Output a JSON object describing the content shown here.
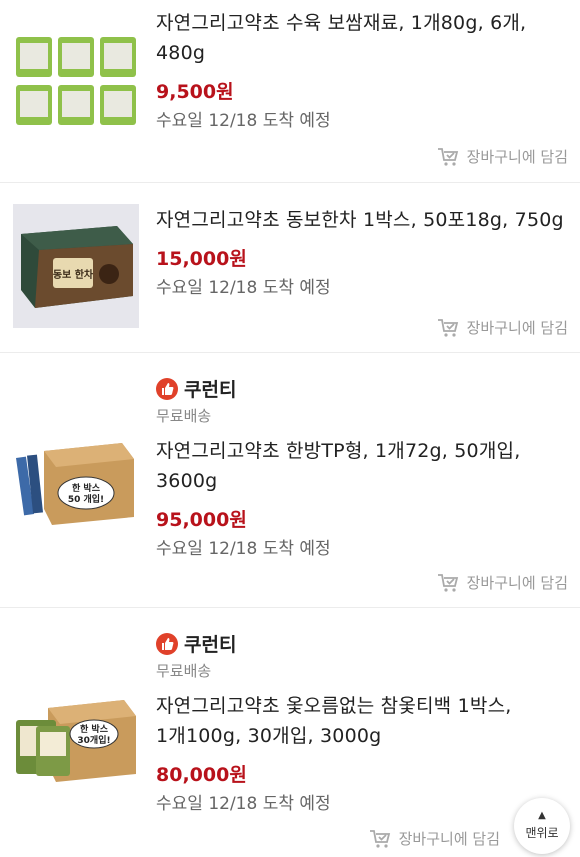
{
  "products": [
    {
      "title_line1": "자연그리고약초 수육 보쌈재료, 1개80g, 6개,",
      "title_line2": "480g",
      "price": "9,500원",
      "delivery": "수요일 12/18 도착 예정",
      "cart_label": "장바구니에 담김"
    },
    {
      "title_line1": "자연그리고약초 동보한차 1박스, 50포18g, 750g",
      "price": "15,000원",
      "delivery": "수요일 12/18 도착 예정",
      "cart_label": "장바구니에 담김",
      "box_text": "동보 한차"
    },
    {
      "brand_icon": "coupang-thumb",
      "brand": "쿠런티",
      "shipping": "무료배송",
      "title_line1": "자연그리고약초 한방TP형, 1개72g, 50개입,",
      "title_line2": "3600g",
      "price": "95,000원",
      "delivery": "수요일 12/18 도착 예정",
      "cart_label": "장바구니에 담김",
      "box_text_1": "한 박스",
      "box_text_2": "50 개입!"
    },
    {
      "brand_icon": "coupang-thumb",
      "brand": "쿠런티",
      "shipping": "무료배송",
      "title_line1": "자연그리고약초 옻오름없는 참옻티백 1박스,",
      "title_line2": "1개100g, 30개입, 3000g",
      "price": "80,000원",
      "delivery": "수요일 12/18 도착 예정",
      "cart_label": "장바구니에 담김",
      "box_text_1": "한 박스",
      "box_text_2": "30개입!"
    }
  ],
  "scroll_top": {
    "label": "맨위로",
    "arrow": "▲"
  },
  "colors": {
    "price": "#b8121b",
    "brand_badge": "#e0412a"
  }
}
